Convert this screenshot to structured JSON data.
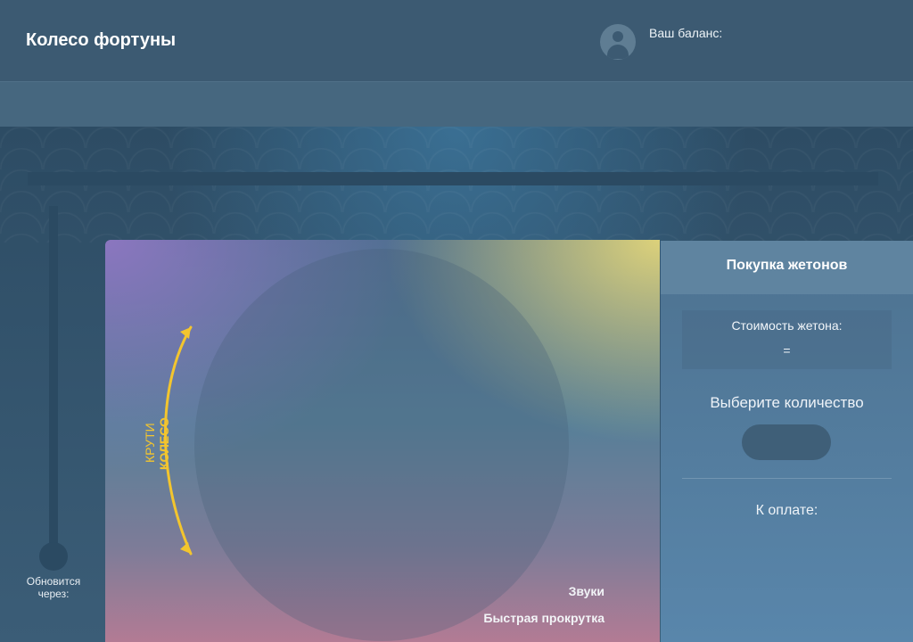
{
  "header": {
    "title": "Колесо фортуны",
    "balance_label": "Ваш баланс:",
    "avatar_icon": "user-avatar-icon"
  },
  "timer": {
    "label": "Обновится через:"
  },
  "wheel": {
    "hint_line1": "КРУТИ",
    "hint_line2": "КОЛЕСО",
    "hint_color": "#f3c52e",
    "sounds_label": "Звуки",
    "fast_spin_label": "Быстрая прокрутка"
  },
  "purchase": {
    "title": "Покупка жетонов",
    "token_cost_label": "Стоимость жетона:",
    "token_cost_value": "=",
    "quantity_label": "Выберите количество",
    "payment_label": "К оплате:"
  }
}
